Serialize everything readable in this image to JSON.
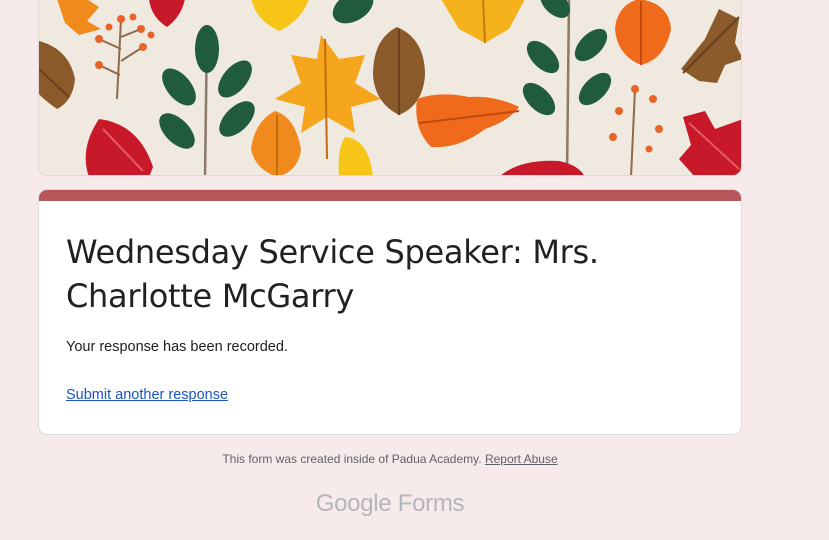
{
  "colors": {
    "page_bg": "#f6eaea",
    "accent": "#b6555a",
    "link": "#1a55c6"
  },
  "header_image": {
    "name": "autumn-leaves-banner"
  },
  "form": {
    "title": "Wednesday Service Speaker: Mrs. Charlotte McGarry",
    "confirmation": "Your response has been recorded.",
    "submit_another": "Submit another response"
  },
  "footer": {
    "created_by": "This form was created inside of Padua Academy.",
    "report_abuse": "Report Abuse"
  },
  "branding": {
    "google": "Google",
    "forms": "Forms"
  }
}
